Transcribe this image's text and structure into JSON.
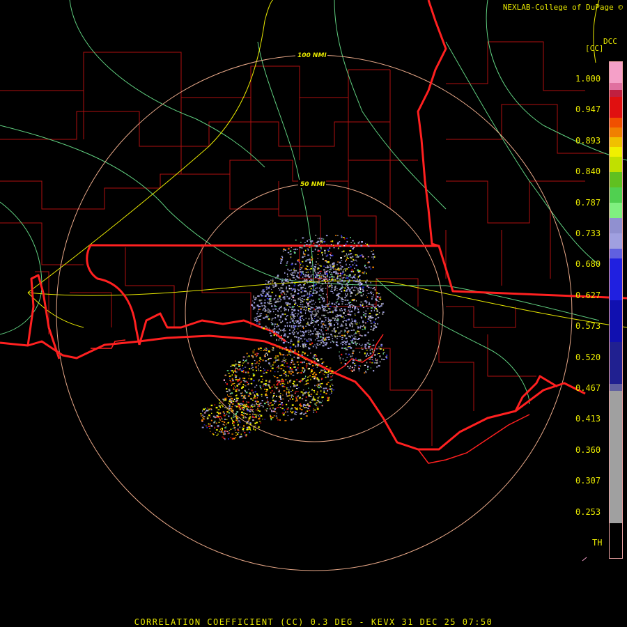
{
  "header": {
    "credit": "NEXLAB-College of DuPage ©",
    "station_tag": "DCC",
    "unit": "[CC]"
  },
  "legend": {
    "ticks": [
      "1.000",
      "0.947",
      "0.893",
      "0.840",
      "0.787",
      "0.733",
      "0.680",
      "0.627",
      "0.573",
      "0.520",
      "0.467",
      "0.413",
      "0.360",
      "0.307",
      "0.253",
      "TH"
    ],
    "colors": {
      "pink": "#f5a0c8",
      "magenta": "#d04070",
      "red": "#e01010",
      "orange": "#f08000",
      "yellow": "#f0f000",
      "green": "#60d020",
      "lightgreen": "#80f080",
      "lavender": "#a0a0e0",
      "blue": "#2020d0",
      "gray": "#a0a0a0",
      "th": "#000000"
    }
  },
  "rings": [
    {
      "label": "100 NMI"
    },
    {
      "label": "50 NMI"
    }
  ],
  "map_colors": {
    "state_border": "#ff2020",
    "county_border": "#c01010",
    "highway_green": "#60d080",
    "highway_yellow": "#e8e800",
    "ring": "#e8a888"
  },
  "footer": {
    "title": "CORRELATION COEFFICIENT (CC) 0.3 DEG - KEVX 31 DEC 25 07:50"
  }
}
